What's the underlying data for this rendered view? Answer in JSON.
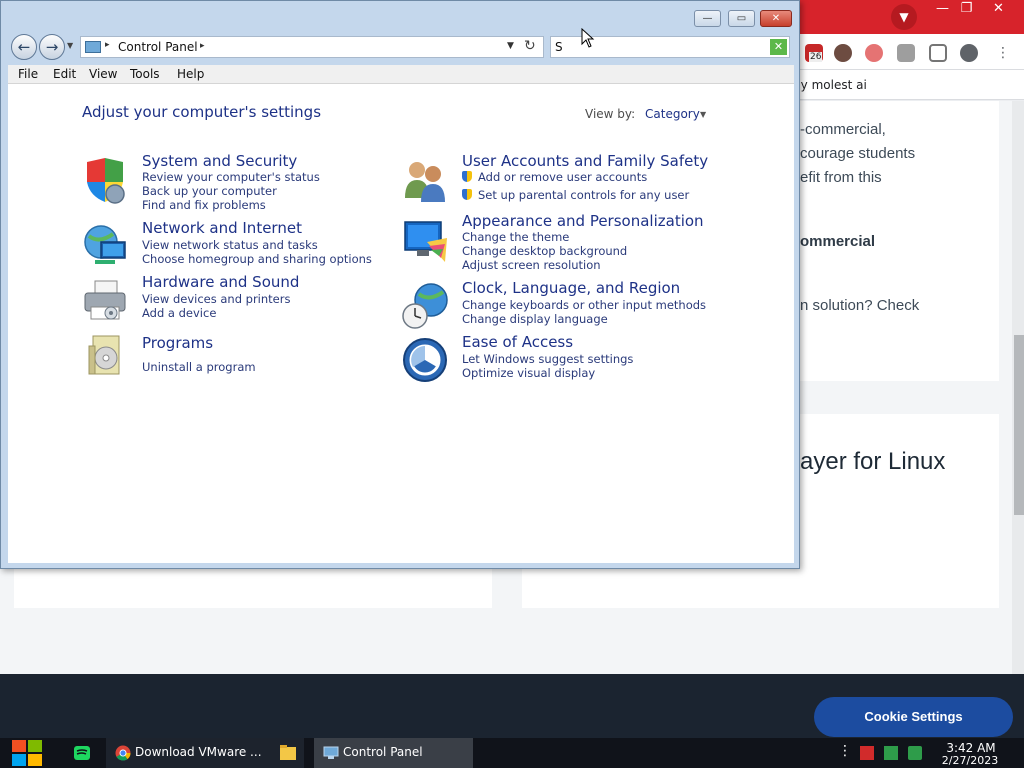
{
  "browser": {
    "extension_badge": "26",
    "bookmark": "lly molest ai",
    "chrome_buttons": {
      "minimize": "—",
      "maximize": "❐",
      "close": "✕"
    },
    "tab_menu": "▼",
    "menu_dots": "⋮",
    "content": {
      "line1": "-commercial,",
      "line2": "courage students",
      "line3": "efit from this",
      "line4": "ommercial",
      "line5": "n solution? Check",
      "heading": "ayer for Linux"
    },
    "cookie_button": "Cookie Settings"
  },
  "control_panel": {
    "window_buttons": {
      "minimize": "—",
      "maximize": "▭",
      "close": "✕"
    },
    "nav": {
      "back": "←",
      "forward": "→",
      "recent": "▼"
    },
    "address": {
      "path": "Control Panel",
      "separator": "▸",
      "dropdown": "▼",
      "refresh": "↻"
    },
    "search": {
      "value": "S",
      "clear": "✕"
    },
    "menu": [
      "File",
      "Edit",
      "View",
      "Tools",
      "Help"
    ],
    "heading": "Adjust your computer's settings",
    "view_by": {
      "label": "View by:",
      "value": "Category",
      "chevron": "▼"
    },
    "categories": [
      {
        "title": "System and Security",
        "icon": "shield-icon",
        "links": [
          "Review your computer's status",
          "Back up your computer",
          "Find and fix problems"
        ]
      },
      {
        "title": "Network and Internet",
        "icon": "globe-network-icon",
        "links": [
          "View network status and tasks",
          "Choose homegroup and sharing options"
        ]
      },
      {
        "title": "Hardware and Sound",
        "icon": "printer-icon",
        "links": [
          "View devices and printers",
          "Add a device"
        ]
      },
      {
        "title": "Programs",
        "icon": "programs-icon",
        "links": [
          "Uninstall a program"
        ]
      },
      {
        "title": "User Accounts and Family Safety",
        "icon": "users-icon",
        "links": [
          "Add or remove user accounts",
          "Set up parental controls for any user"
        ]
      },
      {
        "title": "Appearance and Personalization",
        "icon": "monitor-icon",
        "links": [
          "Change the theme",
          "Change desktop background",
          "Adjust screen resolution"
        ]
      },
      {
        "title": "Clock, Language, and Region",
        "icon": "clock-globe-icon",
        "links": [
          "Change keyboards or other input methods",
          "Change display language"
        ]
      },
      {
        "title": "Ease of Access",
        "icon": "ease-of-access-icon",
        "links": [
          "Let Windows suggest settings",
          "Optimize visual display"
        ]
      }
    ]
  },
  "taskbar": {
    "chrome_label": "Download VMware ...",
    "cp_label": "Control Panel",
    "tray_more": "⋮",
    "time": "3:42 AM",
    "date": "2/27/2023"
  },
  "colors": {
    "chrome_red": "#d7232b",
    "link_blue": "#1e3287",
    "taskbar": "#10131a",
    "cookie_button": "#1c4ca0"
  }
}
